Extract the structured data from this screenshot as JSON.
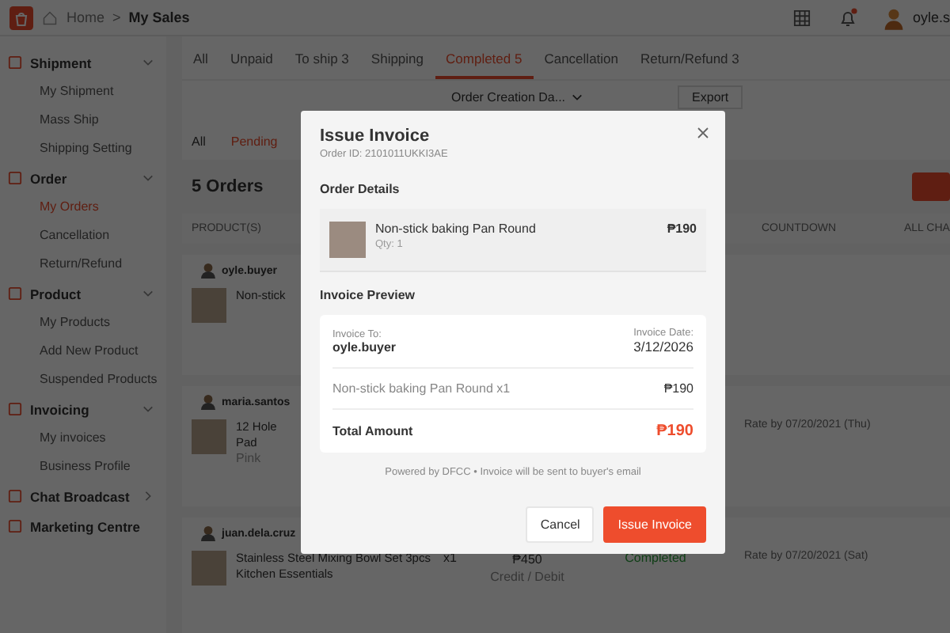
{
  "header": {
    "breadcrumb": [
      {
        "label": "Home",
        "kind": "link"
      },
      {
        "label": ">",
        "kind": "separator"
      },
      {
        "label": "My Sales",
        "kind": "current"
      }
    ],
    "notifications_unread": true,
    "user": "oyle.s"
  },
  "sidebar": {
    "sections": [
      {
        "label": "Shipment",
        "expanded": true,
        "items": [
          {
            "label": "My Shipment",
            "selected": false
          },
          {
            "label": "Mass Ship",
            "selected": false
          },
          {
            "label": "Shipping Setting",
            "selected": false
          }
        ]
      },
      {
        "label": "Order",
        "expanded": true,
        "items": [
          {
            "label": "My Orders",
            "selected": true
          },
          {
            "label": "Cancellation",
            "selected": false
          },
          {
            "label": "Return/Refund",
            "selected": false
          }
        ]
      },
      {
        "label": "Product",
        "expanded": true,
        "items": [
          {
            "label": "My Products",
            "selected": false
          },
          {
            "label": "Add New Product",
            "selected": false
          },
          {
            "label": "Suspended Products",
            "selected": false
          }
        ]
      },
      {
        "label": "Invoicing",
        "expanded": true,
        "items": [
          {
            "label": "My invoices",
            "selected": false
          },
          {
            "label": "Business Profile",
            "selected": false
          }
        ]
      },
      {
        "label": "Chat Broadcast",
        "expanded": false
      },
      {
        "label": "Marketing Centre"
      }
    ]
  },
  "tabs": [
    {
      "label": "All",
      "selected": false
    },
    {
      "label": "Unpaid",
      "selected": false
    },
    {
      "label": "To ship 3",
      "selected": false
    },
    {
      "label": "Shipping",
      "selected": false
    },
    {
      "label": "Completed 5",
      "selected": true
    },
    {
      "label": "Cancellation",
      "selected": false
    },
    {
      "label": "Return/Refund 3",
      "selected": false
    }
  ],
  "filter": {
    "sort": "Order Creation Da...",
    "export": "Export"
  },
  "subtabs": [
    {
      "label": "All",
      "selected": false
    },
    {
      "label": "Pending",
      "selected": true
    }
  ],
  "order_count": "5 Orders",
  "table": {
    "columns": [
      "PRODUCT(S)",
      "COUNTDOWN",
      "ALL CHA"
    ],
    "orders": [
      {
        "buyer": "oyle.buyer",
        "product": "Non-stick"
      },
      {
        "buyer": "maria.santos",
        "product": "12 Hole\nPad",
        "variant": "Pink",
        "countdown": "Rate by 07/20/2021 (Thu)"
      },
      {
        "buyer": "juan.dela.cruz",
        "product": "Stainless Steel Mixing Bowl Set 3pcs\nKitchen Essentials",
        "qty": "x1",
        "price": "₱450",
        "payment": "Credit / Debit",
        "status": "Completed",
        "countdown": "Rate by 07/20/2021 (Sat)"
      }
    ]
  },
  "modal": {
    "title": "Issue Invoice",
    "order_id": "Order ID: 2101011UKKI3AE",
    "details_heading": "Order Details",
    "item": {
      "name": "Non-stick baking Pan Round",
      "qty": "Qty: 1",
      "price": "₱190"
    },
    "preview_heading": "Invoice Preview",
    "invoice": {
      "to_label": "Invoice To:",
      "to": "oyle.buyer",
      "date_label": "Invoice Date:",
      "date": "3/12/2026",
      "line": "Non-stick baking Pan Round x1",
      "line_amount": "₱190",
      "total_label": "Total Amount",
      "total": "₱190"
    },
    "note": "Powered by DFCC • Invoice will be sent to buyer's email",
    "buttons": [
      {
        "label": "Cancel",
        "kind": "secondary"
      },
      {
        "label": "Issue Invoice",
        "kind": "primary"
      }
    ]
  }
}
